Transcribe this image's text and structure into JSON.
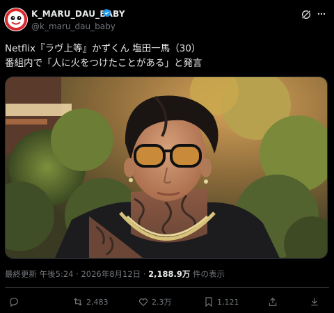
{
  "author": {
    "display_name": "K_MARU_DAU_BABY",
    "handle": "@k_maru_dau_baby",
    "verified": true
  },
  "tweet": {
    "line1": "Netflix『ラヴ上等』かずくん 塩田一馬（30）",
    "line2": "番組内で「人に火をつけたことがある」と発言"
  },
  "meta": {
    "timestamp": "最終更新 午後5:24 · 2026年8月12日 · ",
    "views_count": "2,188.9万",
    "views_label": " 件の表示"
  },
  "actions": {
    "reply_count": "",
    "retweet_count": "2,483",
    "like_count": "2.3万",
    "bookmark_count": "1,121"
  },
  "colors": {
    "background": "#000000",
    "text": "#e7e9ea",
    "muted": "#71767b",
    "verified": "#1d9bf0",
    "avatar_red": "#d8262c"
  },
  "icons": [
    "verified-badge-icon",
    "grok-icon",
    "more-icon",
    "reply-icon",
    "retweet-icon",
    "like-icon",
    "bookmark-icon",
    "share-icon",
    "download-icon"
  ]
}
